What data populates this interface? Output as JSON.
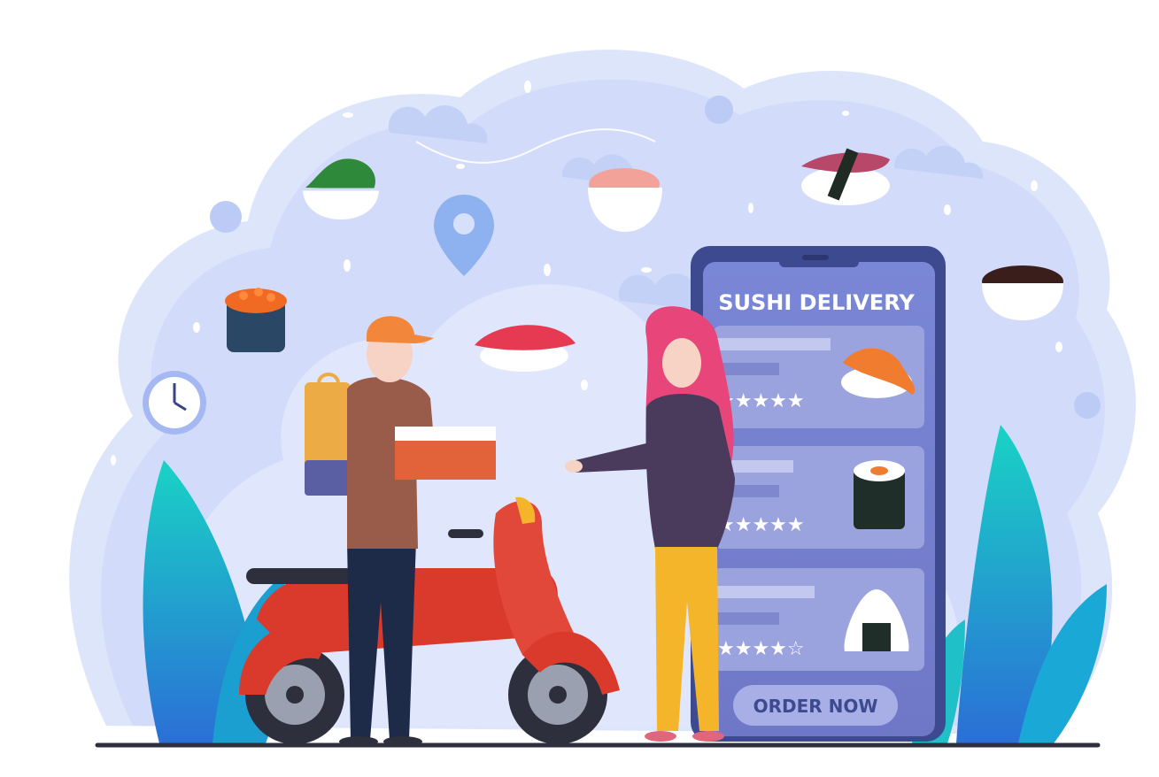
{
  "phone": {
    "title": "SUSHI DELIVERY",
    "cta_label": "ORDER NOW",
    "menu_items": [
      {
        "dish": "shrimp-nigiri",
        "rating": 5
      },
      {
        "dish": "maki-roll",
        "rating": 5
      },
      {
        "dish": "onigiri",
        "rating": 4
      }
    ]
  },
  "icons": {
    "pin": "map-pin-icon",
    "clock": "clock-icon",
    "star": "star-icon"
  },
  "colors": {
    "background_blob": "#d6e0fb",
    "phone_body": "#3d4a8f",
    "phone_screen": "#7e89d4",
    "card": "#9aa3de",
    "scooter": "#d93a2b",
    "leaves": "#1fc2c6",
    "button": "#a7afe6"
  }
}
